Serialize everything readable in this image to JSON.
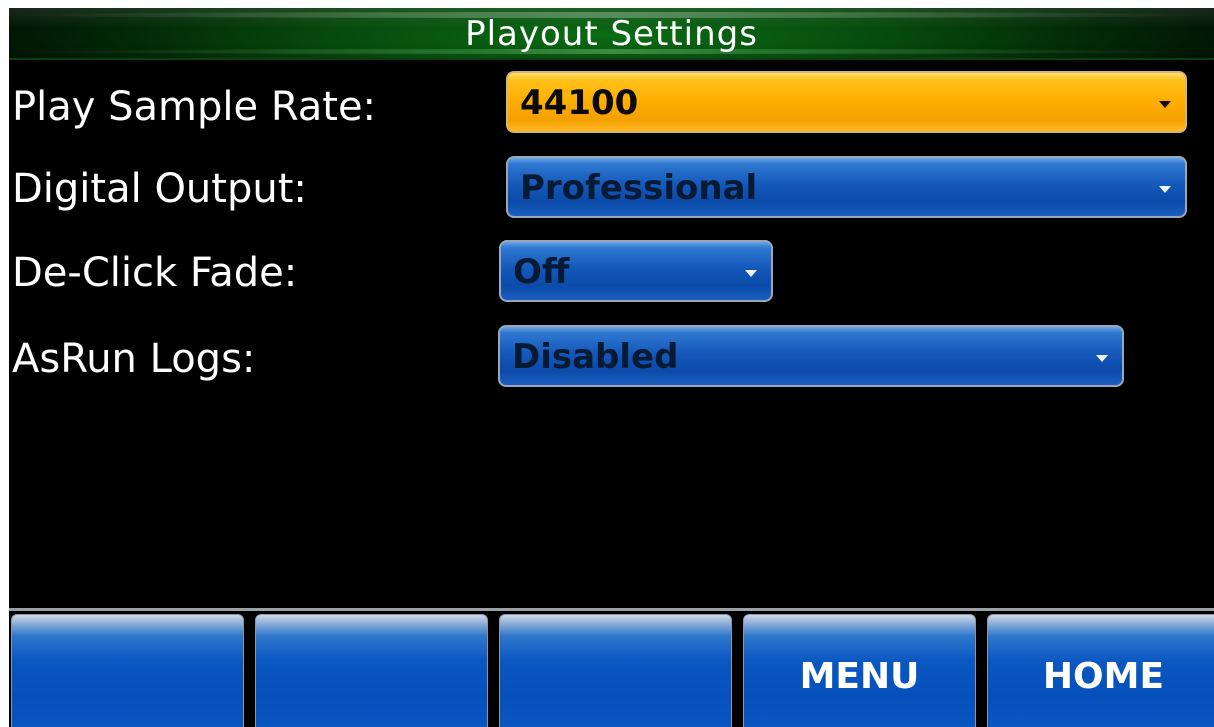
{
  "header": {
    "title": "Playout Settings"
  },
  "settings": [
    {
      "label": "Play Sample Rate:",
      "value": "44100"
    },
    {
      "label": "Digital Output:",
      "value": "Professional"
    },
    {
      "label": "De-Click Fade:",
      "value": "Off"
    },
    {
      "label": "AsRun Logs:",
      "value": "Disabled"
    }
  ],
  "nav": {
    "buttons": [
      {
        "label": ""
      },
      {
        "label": ""
      },
      {
        "label": ""
      },
      {
        "label": "MENU"
      },
      {
        "label": "HOME"
      }
    ]
  },
  "colors": {
    "title_bar": "#06480c",
    "active_select": "#ffad00",
    "select": "#1459bb",
    "nav_button": "#0650bb",
    "background": "#000000",
    "text": "#ffffff"
  },
  "icons": {
    "dropdown": "chevron-down-icon"
  }
}
